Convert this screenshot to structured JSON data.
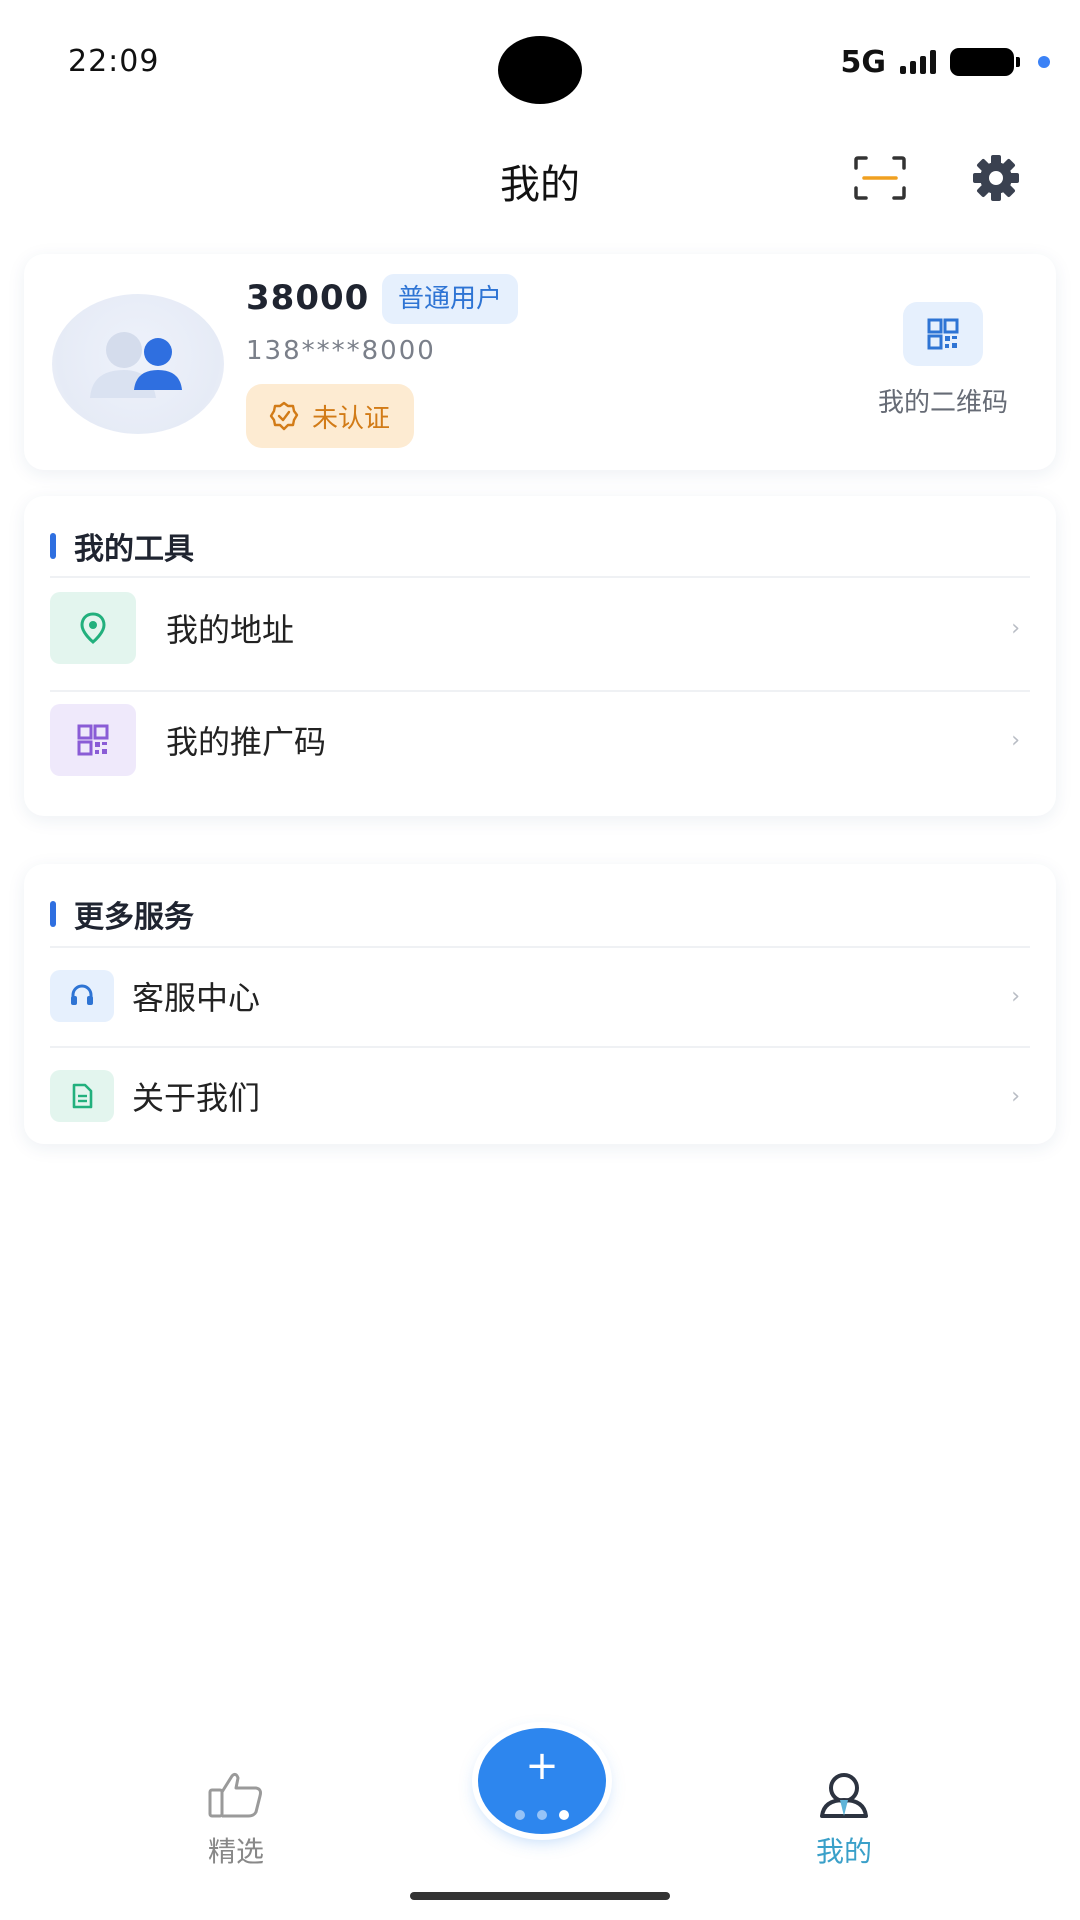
{
  "status_bar": {
    "time": "22:09",
    "network": "5G"
  },
  "header": {
    "title": "我的",
    "scan_icon": "scan-icon",
    "settings_icon": "gear-icon"
  },
  "profile": {
    "username": "38000",
    "badge": "普通用户",
    "phone": "138****8000",
    "verify_status": "未认证",
    "qr_label": "我的二维码"
  },
  "tools": {
    "title": "我的工具",
    "items": [
      {
        "label": "我的地址",
        "icon": "location-pin-icon"
      },
      {
        "label": "我的推广码",
        "icon": "qr-code-icon"
      }
    ]
  },
  "services": {
    "title": "更多服务",
    "items": [
      {
        "label": "客服中心",
        "icon": "headset-icon"
      },
      {
        "label": "关于我们",
        "icon": "document-icon"
      }
    ]
  },
  "tab_bar": {
    "items": [
      {
        "label": "精选",
        "icon": "thumbs-up-icon",
        "active": false
      },
      {
        "label": "我的",
        "icon": "user-icon",
        "active": true
      }
    ],
    "fab_icon": "plus-icon"
  },
  "colors": {
    "accent": "#2F6FE0",
    "fab": "#2D86EE",
    "active_tab": "#3AA0C9",
    "badge_bg": "#E6F0FD",
    "verify_bg": "#FDEBD2",
    "verify_text": "#D27B17"
  }
}
